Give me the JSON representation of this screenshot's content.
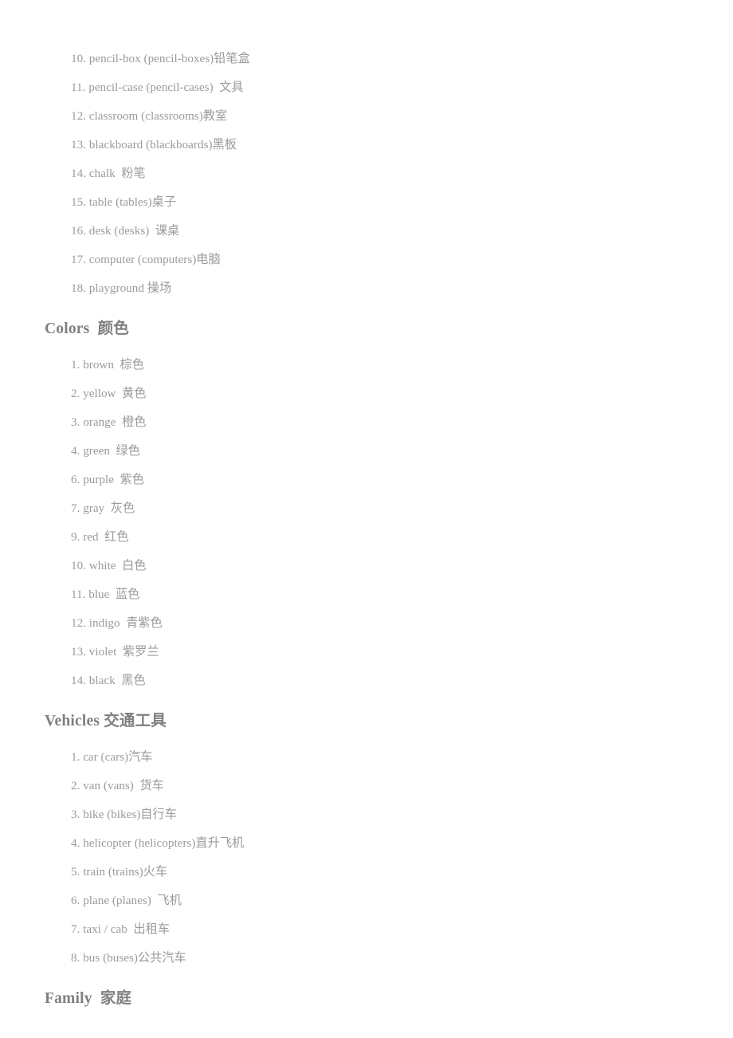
{
  "document": {
    "sections": [
      {
        "id": "school-things-continued",
        "heading": null,
        "items": [
          {
            "num": "10.",
            "text": " pencil-box (pencil-boxes)铅笔盒"
          },
          {
            "num": "11.",
            "text": " pencil-case (pencil-cases)  文具"
          },
          {
            "num": "12.",
            "text": " classroom (classrooms)教室"
          },
          {
            "num": "13.",
            "text": " blackboard (blackboards)黑板"
          },
          {
            "num": "14.",
            "text": " chalk  粉笔"
          },
          {
            "num": "15.",
            "text": " table (tables)桌子"
          },
          {
            "num": "16.",
            "text": " desk (desks)  课桌"
          },
          {
            "num": "17.",
            "text": " computer (computers)电脑"
          },
          {
            "num": "18.",
            "text": " playground 操场"
          }
        ]
      },
      {
        "id": "colors",
        "heading": "Colors  颜色",
        "items": [
          {
            "num": "1.",
            "text": " brown  棕色"
          },
          {
            "num": "2.",
            "text": " yellow  黄色"
          },
          {
            "num": "3.",
            "text": " orange  橙色"
          },
          {
            "num": "4.",
            "text": " green  绿色"
          },
          {
            "num": "6.",
            "text": " purple  紫色"
          },
          {
            "num": "7.",
            "text": " gray  灰色"
          },
          {
            "num": "9.",
            "text": " red  红色"
          },
          {
            "num": "10.",
            "text": " white  白色"
          },
          {
            "num": "11.",
            "text": " blue  蓝色"
          },
          {
            "num": "12.",
            "text": " indigo  青紫色"
          },
          {
            "num": "13.",
            "text": " violet  紫罗兰"
          },
          {
            "num": "14.",
            "text": " black  黑色"
          }
        ]
      },
      {
        "id": "vehicles",
        "heading": "Vehicles 交通工具",
        "items": [
          {
            "num": "1.",
            "text": " car (cars)汽车"
          },
          {
            "num": "2.",
            "text": " van (vans)  货车"
          },
          {
            "num": "3.",
            "text": " bike (bikes)自行车"
          },
          {
            "num": "4.",
            "text": " helicopter (helicopters)直升飞机"
          },
          {
            "num": "5.",
            "text": " train (trains)火车"
          },
          {
            "num": "6.",
            "text": " plane (planes)  飞机"
          },
          {
            "num": "7.",
            "text": " taxi / cab  出租车"
          },
          {
            "num": "8.",
            "text": " bus (buses)公共汽车"
          }
        ]
      },
      {
        "id": "family",
        "heading": "Family  家庭",
        "items": []
      }
    ]
  },
  "style": {
    "heading_color": "#808083",
    "body_color": "#9b9b9e",
    "page_background": "#ffffff"
  }
}
